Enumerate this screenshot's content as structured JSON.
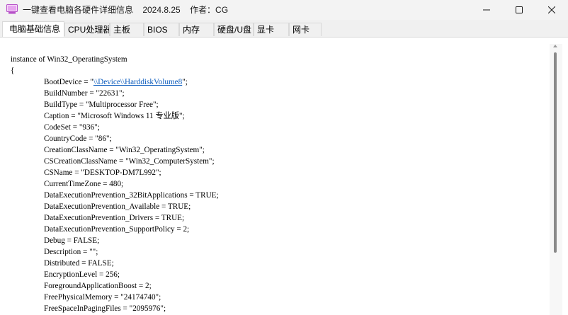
{
  "window": {
    "title": "一键查看电脑各硬件详细信息    2024.8.25    作者：CG",
    "accent": "#b64fc8"
  },
  "tabs": [
    {
      "label": "电脑基础信息",
      "active": true
    },
    {
      "label": "CPU处理器",
      "active": false
    },
    {
      "label": "主板",
      "active": false
    },
    {
      "label": "BIOS",
      "active": false
    },
    {
      "label": "内存",
      "active": false
    },
    {
      "label": "硬盘/U盘",
      "active": false
    },
    {
      "label": "显卡",
      "active": false
    },
    {
      "label": "网卡",
      "active": false
    }
  ],
  "content": {
    "header": "instance of Win32_OperatingSystem",
    "open_brace": "{",
    "bootdevice_prefix": "BootDevice = \"",
    "bootdevice_link": "\\\\Device\\\\HarddiskVolume8",
    "bootdevice_suffix": "\";",
    "lines": [
      "BuildNumber = \"22631\";",
      "BuildType = \"Multiprocessor Free\";",
      "Caption = \"Microsoft Windows 11 专业版\";",
      "CodeSet = \"936\";",
      "CountryCode = \"86\";",
      "CreationClassName = \"Win32_OperatingSystem\";",
      "CSCreationClassName = \"Win32_ComputerSystem\";",
      "CSName = \"DESKTOP-DM7L992\";",
      "CurrentTimeZone = 480;",
      "DataExecutionPrevention_32BitApplications = TRUE;",
      "DataExecutionPrevention_Available = TRUE;",
      "DataExecutionPrevention_Drivers = TRUE;",
      "DataExecutionPrevention_SupportPolicy = 2;",
      "Debug = FALSE;",
      "Description = \"\";",
      "Distributed = FALSE;",
      "EncryptionLevel = 256;",
      "ForegroundApplicationBoost = 2;",
      "FreePhysicalMemory = \"24174740\";",
      "FreeSpaceInPagingFiles = \"2095976\";"
    ]
  }
}
